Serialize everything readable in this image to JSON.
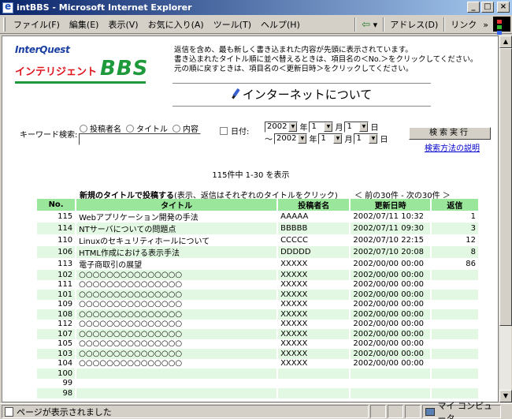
{
  "window": {
    "title": "intBBS - Microsoft Internet Explorer"
  },
  "menu": [
    "ファイル(F)",
    "編集(E)",
    "表示(V)",
    "お気に入り(A)",
    "ツール(T)",
    "ヘルプ(H)"
  ],
  "toolbar": {
    "back_label": "⇦",
    "address_label": "アドレス(D)",
    "links_label": "リンク"
  },
  "logo": {
    "company": "InterQuest",
    "product_kana": "インテリジェント",
    "product_bbs": "BBS"
  },
  "intro": [
    "返信を含め、最も新しく書き込まれた内容が先頭に表示されています。",
    "書き込まれたタイトル順に並べ替えるときは、項目名の＜No.＞をクリックしてください。",
    "元の順に戻すときは、項目名の＜更新日時＞をクリックしてください。"
  ],
  "page_title": "インターネットについて",
  "search": {
    "keyword_label": "キーワード検索:",
    "radio_poster": "投稿者名",
    "radio_title": "タイトル",
    "radio_content": "内容",
    "date_label": "日付:",
    "from_year": "2002",
    "from_month": "1",
    "from_day": "1",
    "to_prefix": "～",
    "to_year": "2002",
    "to_month": "1",
    "to_day": "1",
    "year_unit": "年",
    "month_unit": "月",
    "day_unit": "日",
    "button_label": "検索実行",
    "help_link": "検索方法の説明"
  },
  "count_text": "115件中 1-30 を表示",
  "new_post": {
    "link": "新規のタイトルで投稿する",
    "note": "(表示、返信はそれぞれのタイトルをクリック)"
  },
  "pager": "＜ 前の30件 - 次の30件 ＞",
  "table": {
    "headers": [
      "No.",
      "タイトル",
      "投稿者名",
      "更新日時",
      "返信"
    ],
    "rows": [
      {
        "no": "115",
        "title": "Webアプリケーション開発の手法",
        "poster": "AAAAA",
        "date": "2002/07/11 10:32",
        "replies": "1"
      },
      {
        "no": "114",
        "title": "NTサーバについての問題点",
        "poster": "BBBBB",
        "date": "2002/07/11 09:30",
        "replies": "3"
      },
      {
        "no": "110",
        "title": "Linuxのセキュリティホールについて",
        "poster": "CCCCC",
        "date": "2002/07/10 22:15",
        "replies": "12"
      },
      {
        "no": "106",
        "title": "HTML作成における表示手法",
        "poster": "DDDDD",
        "date": "2002/07/10 20:08",
        "replies": "8"
      },
      {
        "no": "113",
        "title": "電子商取引の展望",
        "poster": "XXXXX",
        "date": "2002/00/00 00:00",
        "replies": "86"
      },
      {
        "no": "102",
        "title": "○○○○○○○○○○○○○○○",
        "poster": "XXXXX",
        "date": "2002/00/00 00:00",
        "replies": ""
      },
      {
        "no": "111",
        "title": "○○○○○○○○○○○○○○○",
        "poster": "XXXXX",
        "date": "2002/00/00 00:00",
        "replies": ""
      },
      {
        "no": "101",
        "title": "○○○○○○○○○○○○○○○",
        "poster": "XXXXX",
        "date": "2002/00/00 00:00",
        "replies": ""
      },
      {
        "no": "109",
        "title": "○○○○○○○○○○○○○○○",
        "poster": "XXXXX",
        "date": "2002/00/00 00:00",
        "replies": ""
      },
      {
        "no": "108",
        "title": "○○○○○○○○○○○○○○○",
        "poster": "XXXXX",
        "date": "2002/00/00 00:00",
        "replies": ""
      },
      {
        "no": "112",
        "title": "○○○○○○○○○○○○○○○",
        "poster": "XXXXX",
        "date": "2002/00/00 00:00",
        "replies": ""
      },
      {
        "no": "107",
        "title": "○○○○○○○○○○○○○○○",
        "poster": "XXXXX",
        "date": "2002/00/00 00:00",
        "replies": ""
      },
      {
        "no": "105",
        "title": "○○○○○○○○○○○○○○○",
        "poster": "XXXXX",
        "date": "2002/00/00 00:00",
        "replies": ""
      },
      {
        "no": "103",
        "title": "○○○○○○○○○○○○○○○",
        "poster": "XXXXX",
        "date": "2002/00/00 00:00",
        "replies": ""
      },
      {
        "no": "104",
        "title": "○○○○○○○○○○○○○○○",
        "poster": "XXXXX",
        "date": "2002/00/00 00:00",
        "replies": ""
      },
      {
        "no": "100",
        "title": "",
        "poster": "",
        "date": "",
        "replies": ""
      },
      {
        "no": "99",
        "title": "",
        "poster": "",
        "date": "",
        "replies": ""
      },
      {
        "no": "98",
        "title": "",
        "poster": "",
        "date": "",
        "replies": ""
      }
    ]
  },
  "status": {
    "text": "ページが表示されました",
    "zone": "マイ コンピュータ"
  },
  "colors": {
    "header_green": "#9ae69a",
    "row_alt": "#e2f8e2",
    "logo_red": "#e0141c",
    "logo_green": "#1e9a3c",
    "titlebar": "#0a246a"
  }
}
